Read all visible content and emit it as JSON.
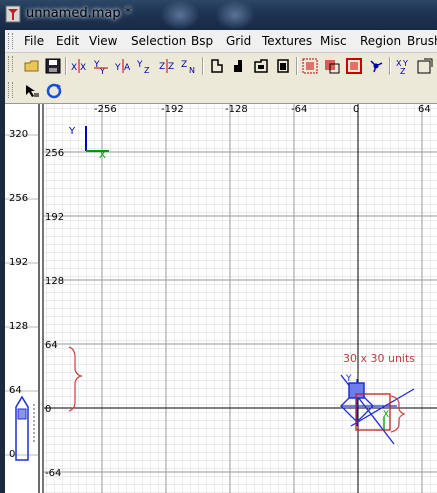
{
  "window": {
    "title": "unnamed.map *"
  },
  "menu": [
    "File",
    "Edit",
    "View",
    "Selection",
    "Bsp",
    "Grid",
    "Textures",
    "Misc",
    "Region",
    "Brush"
  ],
  "toolbar": {
    "row1": [
      "open-file-icon",
      "save-icon",
      "flip-x-icon",
      "flip-y-icon",
      "flip-z-icon",
      "rotate-x-icon",
      "rotate-y-icon",
      "rotate-z-icon",
      "clipper-icon",
      "cubic-clip-icon",
      "texture-lock-icon",
      "camera-icon",
      "entity-icon",
      "select-touching-icon",
      "select-inside-icon",
      "csg-subtract-icon",
      "patch-icon",
      "xyz-view-icon",
      "scale-icon"
    ],
    "row2": [
      "pointer-icon",
      "rotate-icon"
    ]
  },
  "grid_view": {
    "x_axis_ticks": [
      "-256",
      "-192",
      "-128",
      "-64",
      "0",
      "64"
    ],
    "y_axis_ticks": [
      "256",
      "192",
      "128",
      "64",
      "0",
      "-64"
    ],
    "axis_gizmo": {
      "vertical_label": "Y",
      "horizontal_label": "X"
    },
    "annotation": "30 x 30 units",
    "selection_axis_labels": {
      "x": "X",
      "y": "Y"
    }
  },
  "z_view": {
    "ticks": [
      "320",
      "256",
      "192",
      "128",
      "64",
      "0"
    ]
  },
  "colors": {
    "grid_minor": "#d9d9d9",
    "grid_major": "#9a9a9a",
    "axis_y": "#0000cc",
    "axis_x": "#009900",
    "annotation": "#c04040",
    "selection": "#1e2fd6",
    "brush_outline": "#c02020"
  }
}
